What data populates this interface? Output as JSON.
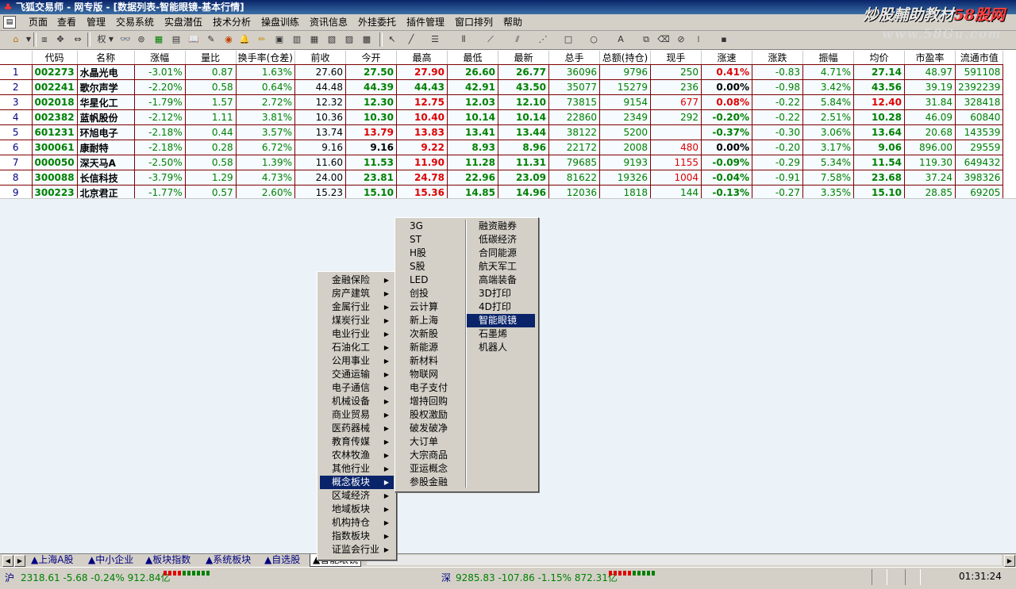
{
  "app": {
    "title": "飞狐交易师 - 网专版 - [数据列表-智能眼镜-基本行情]"
  },
  "watermark": {
    "line1_main": "炒股輔助教材",
    "line1_accent": "58股网",
    "line2": "www.58Gu.com"
  },
  "menubar": {
    "items": [
      "页面",
      "查看",
      "管理",
      "交易系统",
      "实盘潜伍",
      "技术分析",
      "操盘训练",
      "资讯信息",
      "外挂委托",
      "插件管理",
      "窗口排列",
      "帮助"
    ]
  },
  "toolbar": {
    "zoom_label": "权"
  },
  "table": {
    "headers": [
      "",
      "代码",
      "名称",
      "涨幅",
      "量比",
      "换手率(仓差)",
      "前收",
      "今开",
      "最高",
      "最低",
      "最新",
      "总手",
      "总额(持仓)",
      "现手",
      "涨速",
      "涨跌",
      "振幅",
      "均价",
      "市盈率",
      "流通市值"
    ],
    "rows": [
      {
        "idx": "1",
        "code": "002273",
        "name": "水晶光电",
        "chg": "-3.01%",
        "volratio": "0.87",
        "turnover": "1.63%",
        "prev": "27.60",
        "open": "27.50",
        "high": "27.90",
        "low": "26.60",
        "last": "26.77",
        "vol": "36096",
        "amount": "9796",
        "cur": "250",
        "speed": "0.41%",
        "updown": "-0.83",
        "amp": "4.71%",
        "avg": "27.14",
        "pe": "48.97",
        "mcap": "591108"
      },
      {
        "idx": "2",
        "code": "002241",
        "name": "歌尔声学",
        "chg": "-2.20%",
        "volratio": "0.58",
        "turnover": "0.64%",
        "prev": "44.48",
        "open": "44.39",
        "high": "44.43",
        "low": "42.91",
        "last": "43.50",
        "vol": "35077",
        "amount": "15279",
        "cur": "236",
        "speed": "0.00%",
        "updown": "-0.98",
        "amp": "3.42%",
        "avg": "43.56",
        "pe": "39.19",
        "mcap": "2392239"
      },
      {
        "idx": "3",
        "code": "002018",
        "name": "华星化工",
        "chg": "-1.79%",
        "volratio": "1.57",
        "turnover": "2.72%",
        "prev": "12.32",
        "open": "12.30",
        "high": "12.75",
        "low": "12.03",
        "last": "12.10",
        "vol": "73815",
        "amount": "9154",
        "cur": "677",
        "speed": "0.08%",
        "updown": "-0.22",
        "amp": "5.84%",
        "avg": "12.40",
        "pe": "31.84",
        "mcap": "328418"
      },
      {
        "idx": "4",
        "code": "002382",
        "name": "蓝帆股份",
        "chg": "-2.12%",
        "volratio": "1.11",
        "turnover": "3.81%",
        "prev": "10.36",
        "open": "10.30",
        "high": "10.40",
        "low": "10.14",
        "last": "10.14",
        "vol": "22860",
        "amount": "2349",
        "cur": "292",
        "speed": "-0.20%",
        "updown": "-0.22",
        "amp": "2.51%",
        "avg": "10.28",
        "pe": "46.09",
        "mcap": "60840"
      },
      {
        "idx": "5",
        "code": "601231",
        "name": "环旭电子",
        "chg": "-2.18%",
        "volratio": "0.44",
        "turnover": "3.57%",
        "prev": "13.74",
        "open": "13.79",
        "high": "13.83",
        "low": "13.41",
        "last": "13.44",
        "vol": "38122",
        "amount": "5200",
        "cur": "",
        "speed": "-0.37%",
        "updown": "-0.30",
        "amp": "3.06%",
        "avg": "13.64",
        "pe": "20.68",
        "mcap": "143539"
      },
      {
        "idx": "6",
        "code": "300061",
        "name": "康耐特",
        "chg": "-2.18%",
        "volratio": "0.28",
        "turnover": "6.72%",
        "prev": "9.16",
        "open": "9.16",
        "high": "9.22",
        "low": "8.93",
        "last": "8.96",
        "vol": "22172",
        "amount": "2008",
        "cur": "480",
        "speed": "0.00%",
        "updown": "-0.20",
        "amp": "3.17%",
        "avg": "9.06",
        "pe": "896.00",
        "mcap": "29559"
      },
      {
        "idx": "7",
        "code": "000050",
        "name": "深天马A",
        "chg": "-2.50%",
        "volratio": "0.58",
        "turnover": "1.39%",
        "prev": "11.60",
        "open": "11.53",
        "high": "11.90",
        "low": "11.28",
        "last": "11.31",
        "vol": "79685",
        "amount": "9193",
        "cur": "1155",
        "speed": "-0.09%",
        "updown": "-0.29",
        "amp": "5.34%",
        "avg": "11.54",
        "pe": "119.30",
        "mcap": "649432"
      },
      {
        "idx": "8",
        "code": "300088",
        "name": "长信科技",
        "chg": "-3.79%",
        "volratio": "1.29",
        "turnover": "4.73%",
        "prev": "24.00",
        "open": "23.81",
        "high": "24.78",
        "low": "22.96",
        "last": "23.09",
        "vol": "81622",
        "amount": "19326",
        "cur": "1004",
        "speed": "-0.04%",
        "updown": "-0.91",
        "amp": "7.58%",
        "avg": "23.68",
        "pe": "37.24",
        "mcap": "398326"
      },
      {
        "idx": "9",
        "code": "300223",
        "name": "北京君正",
        "chg": "-1.77%",
        "volratio": "0.57",
        "turnover": "2.60%",
        "prev": "15.23",
        "open": "15.10",
        "high": "15.36",
        "low": "14.85",
        "last": "14.96",
        "vol": "12036",
        "amount": "1818",
        "cur": "144",
        "speed": "-0.13%",
        "updown": "-0.27",
        "amp": "3.35%",
        "avg": "15.10",
        "pe": "28.85",
        "mcap": "69205"
      }
    ]
  },
  "menus": {
    "main": [
      "金融保险",
      "房产建筑",
      "金属行业",
      "煤炭行业",
      "电业行业",
      "石油化工",
      "公用事业",
      "交通运输",
      "电子通信",
      "机械设备",
      "商业贸易",
      "医药器械",
      "教育传媒",
      "农林牧渔",
      "其他行业",
      "概念板块",
      "区域经济",
      "地域板块",
      "机构持仓",
      "指数板块",
      "证监会行业"
    ],
    "concept_col1": [
      "3G",
      "ST",
      "H股",
      "S股",
      "LED",
      "创投",
      "云计算",
      "新上海",
      "次新股",
      "新能源",
      "新材料",
      "物联网",
      "电子支付",
      "增持回购",
      "股权激励",
      "破发破净",
      "大订单",
      "大宗商品",
      "亚运概念",
      "参股金融"
    ],
    "concept_col2": [
      "融资融券",
      "低碳经济",
      "合同能源",
      "航天军工",
      "高端装备",
      "3D打印",
      "4D打印",
      "智能眼镜",
      "石墨烯",
      "机器人"
    ]
  },
  "tabs": [
    "上海A股",
    "中小企业",
    "板块指数",
    "系统板块",
    "自选股",
    "智能眼镜"
  ],
  "status": {
    "sh_label": "沪",
    "sh_text": "2318.61 -5.68 -0.24% 912.84亿",
    "sz_label": "深",
    "sz_text": "9285.83 -107.86 -1.15% 872.31亿",
    "time": "01:31:24"
  },
  "colors": {
    "up": "#e00000",
    "down": "#008000",
    "menu_highlight": "#0a246a",
    "chrome": "#d4d0c8"
  }
}
